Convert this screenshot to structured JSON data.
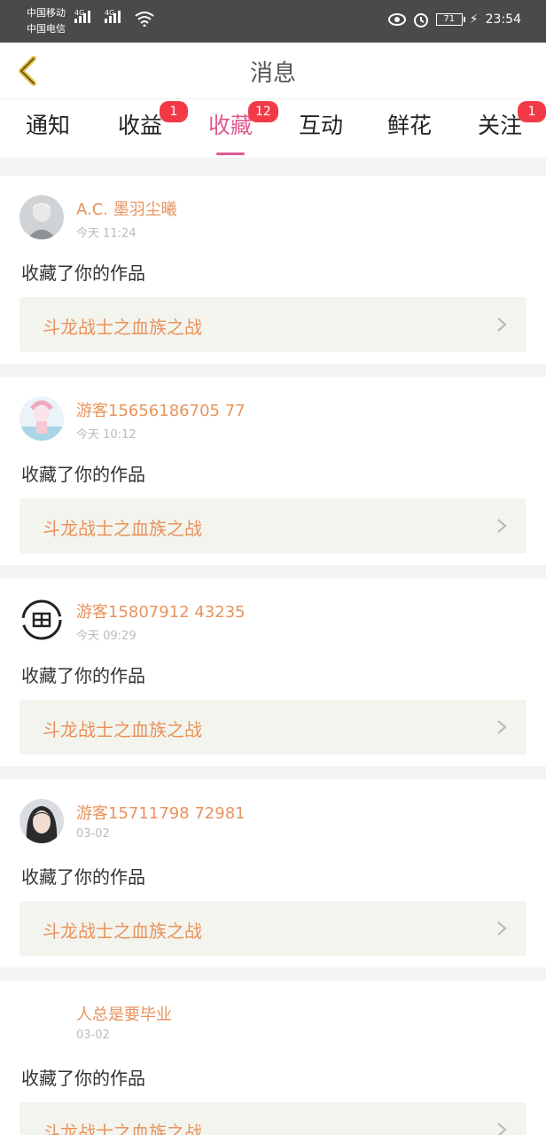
{
  "status_bar": {
    "carrier1": "中国移动",
    "carrier2": "中国电信",
    "network1": "4G",
    "network2": "4G",
    "battery": "71",
    "time": "23:54"
  },
  "header": {
    "title": "消息"
  },
  "tabs": [
    {
      "label": "通知",
      "badge": ""
    },
    {
      "label": "收益",
      "badge": "1"
    },
    {
      "label": "收藏",
      "badge": "12",
      "active": true
    },
    {
      "label": "互动",
      "badge": ""
    },
    {
      "label": "鲜花",
      "badge": ""
    },
    {
      "label": "关注",
      "badge": "1"
    }
  ],
  "notifications": [
    {
      "user": "A.C. 墨羽尘曦",
      "time": "今天 11:24",
      "action": "收藏了你的作品",
      "work": "斗龙战士之血族之战"
    },
    {
      "user": "游客15656186705 77",
      "time": "今天 10:12",
      "action": "收藏了你的作品",
      "work": "斗龙战士之血族之战"
    },
    {
      "user": "游客15807912 43235",
      "time": "今天 09:29",
      "action": "收藏了你的作品",
      "work": "斗龙战士之血族之战"
    },
    {
      "user": "游客15711798 72981",
      "time": "03-02",
      "action": "收藏了你的作品",
      "work": "斗龙战士之血族之战"
    },
    {
      "user": "人总是要毕业",
      "time": "03-02",
      "action": "收藏了你的作品",
      "work": "斗龙战士之血族之战"
    }
  ],
  "colors": {
    "accent": "#e05a8f",
    "username": "#e8935c",
    "badge": "#f23a47"
  }
}
